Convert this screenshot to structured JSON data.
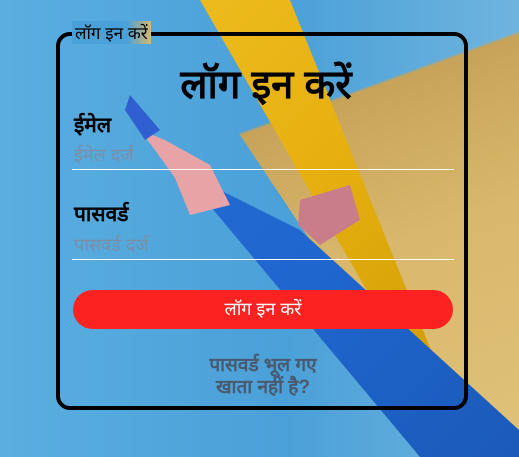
{
  "form": {
    "legend": "लॉग इन करें",
    "title": "लॉग इन करें",
    "email": {
      "label": "ईमेल",
      "placeholder": "ईमेल दर्ज"
    },
    "password": {
      "label": "पासवर्ड",
      "placeholder": "पासवर्ड दर्ज"
    },
    "submit_label": "लॉग इन करें",
    "forgot_password": "पासवर्ड भूल गए",
    "no_account": "खाता नहीं है?"
  },
  "colors": {
    "button": "#fc2222",
    "border": "#000000",
    "link": "#4a5a6e"
  }
}
